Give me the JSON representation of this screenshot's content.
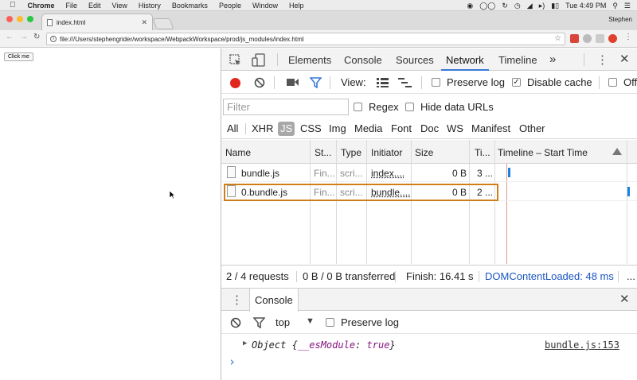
{
  "menubar": {
    "apple": "",
    "app_name": "Chrome",
    "items": [
      "File",
      "Edit",
      "View",
      "History",
      "Bookmarks",
      "People",
      "Window",
      "Help"
    ],
    "clock": "Tue 4:49 PM"
  },
  "browser": {
    "tab_title": "index.html",
    "profile": "Stephen",
    "url": "file:///Users/stephengrider/workspace/WebpackWorkspace/prod/js_modules/index.html"
  },
  "page": {
    "button_label": "Click me"
  },
  "devtools": {
    "tabs": [
      "Elements",
      "Console",
      "Sources",
      "Network",
      "Timeline"
    ],
    "active_tab": "Network",
    "more": "»",
    "network_toolbar": {
      "view_label": "View:",
      "preserve_log": "Preserve log",
      "preserve_log_checked": false,
      "disable_cache": "Disable cache",
      "disable_cache_checked": true,
      "offline": "Offl"
    },
    "filter": {
      "placeholder": "Filter",
      "regex": "Regex",
      "hide_data_urls": "Hide data URLs"
    },
    "types": [
      "All",
      "XHR",
      "JS",
      "CSS",
      "Img",
      "Media",
      "Font",
      "Doc",
      "WS",
      "Manifest",
      "Other"
    ],
    "active_type": "JS",
    "columns": [
      "Name",
      "St...",
      "Type",
      "Initiator",
      "Size",
      "Ti...",
      "Timeline – Start Time"
    ],
    "requests": [
      {
        "name": "bundle.js",
        "status": "Fin...",
        "type": "scri...",
        "initiator": "index....",
        "size": "0 B",
        "time": "3 ..."
      },
      {
        "name": "0.bundle.js",
        "status": "Fin...",
        "type": "scri...",
        "initiator": "bundle....",
        "size": "0 B",
        "time": "2 ..."
      }
    ],
    "status": {
      "requests": "2 / 4 requests",
      "transferred": "0 B / 0 B transferred",
      "finish": "Finish: 16.41 s",
      "dom_content_loaded": "DOMContentLoaded: 48 ms",
      "more": "..."
    },
    "drawer": {
      "tab": "Console",
      "context": "top",
      "preserve_log": "Preserve log",
      "log_prefix": "Object {",
      "log_key": "__esModule",
      "log_colon": ":",
      "log_value": "true",
      "log_suffix": "}",
      "log_source": "bundle.js:153",
      "prompt": "›"
    }
  },
  "colors": {
    "accent_blue": "#3879d9",
    "record_red": "#e0261e",
    "selection_orange": "#cf7f19",
    "timeline_bar": "#1a82e2",
    "link_blue": "#1a55c2"
  }
}
